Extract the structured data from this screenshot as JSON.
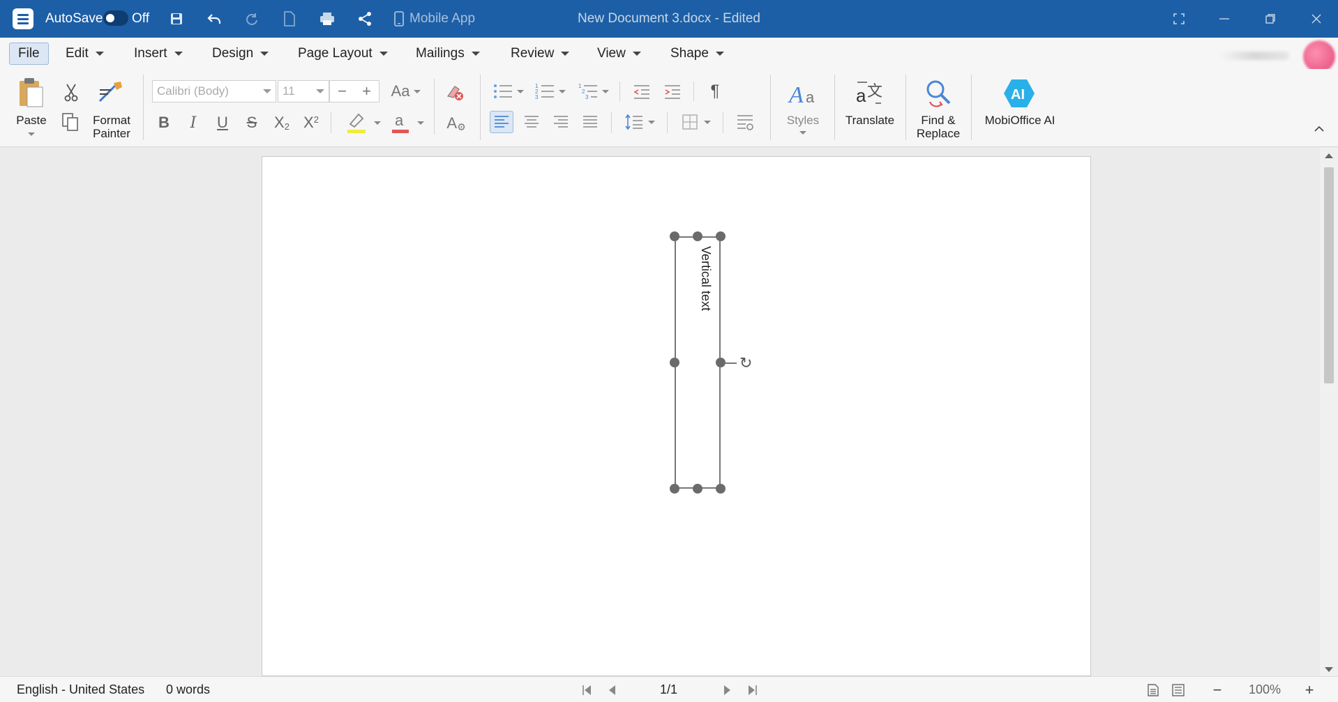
{
  "app": {
    "autosave_label": "AutoSave",
    "autosave_state": "Off",
    "mobile_app_label": "Mobile App",
    "document_title": "New Document 3.docx - Edited",
    "colors": {
      "title_bar": "#1d5fa6",
      "selected": "#dce7f5"
    }
  },
  "menu": {
    "items": [
      "File",
      "Edit",
      "Insert",
      "Design",
      "Page Layout",
      "Mailings",
      "Review",
      "View",
      "Shape"
    ],
    "active": "File"
  },
  "ribbon": {
    "paste": "Paste",
    "format_painter_line1": "Format",
    "format_painter_line2": "Painter",
    "font_name": "Calibri (Body)",
    "font_size": "11",
    "change_case": "Aa",
    "styles": "Styles",
    "translate": "Translate",
    "find_replace_line1": "Find &",
    "find_replace_line2": "Replace",
    "ai_badge": "AI",
    "mobioffice_ai": "MobiOffice AI"
  },
  "document": {
    "textbox_text": "Vertical text"
  },
  "status": {
    "language": "English - United States",
    "word_count": "0 words",
    "page": "1/1",
    "zoom": "100%"
  }
}
